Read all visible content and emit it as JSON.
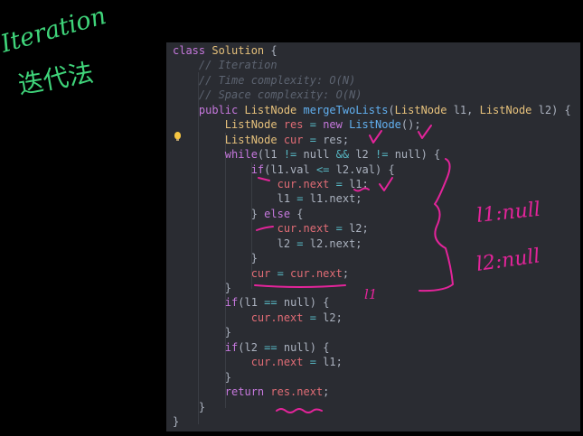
{
  "editor": {
    "lines": [
      [
        [
          "class ",
          "k"
        ],
        [
          "Solution ",
          "t"
        ],
        [
          "{",
          "p"
        ]
      ],
      [
        [
          "    // Iteration",
          "c"
        ]
      ],
      [
        [
          "    // Time complexity: O(N)",
          "c"
        ]
      ],
      [
        [
          "    // Space complexity: O(N)",
          "c"
        ]
      ],
      [
        [
          "    public ",
          "k"
        ],
        [
          "ListNode ",
          "t"
        ],
        [
          "mergeTwoLists",
          "f"
        ],
        [
          "(",
          "p"
        ],
        [
          "ListNode ",
          "t"
        ],
        [
          "l1, ",
          "p"
        ],
        [
          "ListNode ",
          "t"
        ],
        [
          "l2) {",
          "p"
        ]
      ],
      [
        [
          "        ListNode ",
          "t"
        ],
        [
          "res ",
          "v"
        ],
        [
          "= ",
          "o"
        ],
        [
          "new ",
          "k"
        ],
        [
          "ListNode",
          "f"
        ],
        [
          "();",
          "p"
        ]
      ],
      [
        [
          "        ListNode ",
          "t"
        ],
        [
          "cur ",
          "v"
        ],
        [
          "= ",
          "o"
        ],
        [
          "res;",
          "p"
        ]
      ],
      [
        [
          "        while",
          "k"
        ],
        [
          "(l1 ",
          "p"
        ],
        [
          "!= ",
          "o"
        ],
        [
          "null ",
          "p"
        ],
        [
          "&& ",
          "o"
        ],
        [
          "l2 ",
          "p"
        ],
        [
          "!= ",
          "o"
        ],
        [
          "null) {",
          "p"
        ]
      ],
      [
        [
          "            if",
          "k"
        ],
        [
          "(l1.val ",
          "p"
        ],
        [
          "<= ",
          "o"
        ],
        [
          "l2.val) {",
          "p"
        ]
      ],
      [
        [
          "                cur.next ",
          "v"
        ],
        [
          "= ",
          "o"
        ],
        [
          "l1;",
          "p"
        ]
      ],
      [
        [
          "                l1 ",
          "p"
        ],
        [
          "= ",
          "o"
        ],
        [
          "l1.next;",
          "p"
        ]
      ],
      [
        [
          "            } ",
          "p"
        ],
        [
          "else ",
          "k"
        ],
        [
          "{",
          "p"
        ]
      ],
      [
        [
          "                cur.next ",
          "v"
        ],
        [
          "= ",
          "o"
        ],
        [
          "l2;",
          "p"
        ]
      ],
      [
        [
          "                l2 ",
          "p"
        ],
        [
          "= ",
          "o"
        ],
        [
          "l2.next;",
          "p"
        ]
      ],
      [
        [
          "            }",
          "p"
        ]
      ],
      [
        [
          "            cur ",
          "v"
        ],
        [
          "= ",
          "o"
        ],
        [
          "cur.next",
          "v"
        ],
        [
          ";",
          "p"
        ]
      ],
      [
        [
          "        }",
          "p"
        ]
      ],
      [
        [
          "        if",
          "k"
        ],
        [
          "(l1 ",
          "p"
        ],
        [
          "== ",
          "o"
        ],
        [
          "null) {",
          "p"
        ]
      ],
      [
        [
          "            cur.next ",
          "v"
        ],
        [
          "= ",
          "o"
        ],
        [
          "l2;",
          "p"
        ]
      ],
      [
        [
          "        }",
          "p"
        ]
      ],
      [
        [
          "        if",
          "k"
        ],
        [
          "(l2 ",
          "p"
        ],
        [
          "== ",
          "o"
        ],
        [
          "null) {",
          "p"
        ]
      ],
      [
        [
          "            cur.next ",
          "v"
        ],
        [
          "= ",
          "o"
        ],
        [
          "l1;",
          "p"
        ]
      ],
      [
        [
          "        }",
          "p"
        ]
      ],
      [
        [
          "        return ",
          "k"
        ],
        [
          "res.next",
          "v"
        ],
        [
          ";",
          "p"
        ]
      ],
      [
        [
          "    }",
          "p"
        ]
      ],
      [
        [
          "}",
          "p"
        ]
      ]
    ]
  },
  "annotations": {
    "title_en": "Iteration",
    "title_zh": "迭代法",
    "note1": "l1:null",
    "note2": "l2:null",
    "note3": "l1",
    "ink_green": "#3fd47a",
    "ink_pink": "#e3249a"
  }
}
